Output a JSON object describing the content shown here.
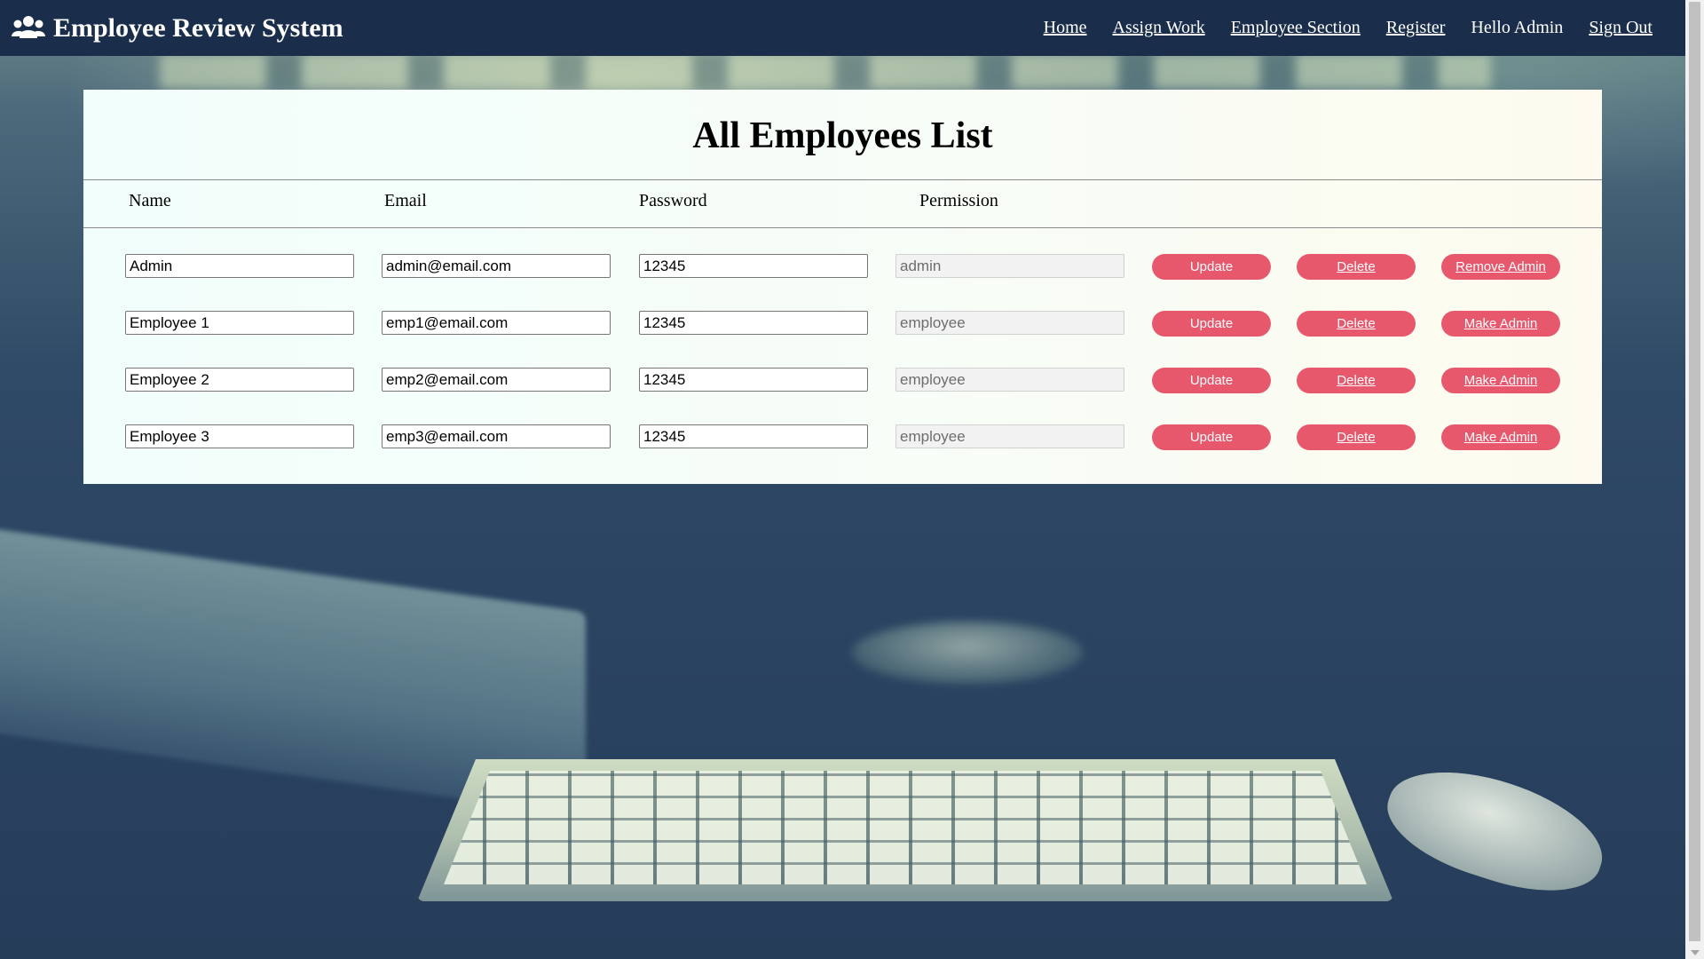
{
  "navbar": {
    "brand_icon": "users-icon",
    "brand_title": "Employee Review System",
    "links": {
      "home": "Home",
      "assign_work": "Assign Work",
      "employee_section": "Employee Section",
      "register": "Register",
      "greeting": "Hello Admin",
      "sign_out": "Sign Out"
    },
    "background_color": "#1a2e4c"
  },
  "panel": {
    "title": "All Employees List",
    "columns": {
      "name": "Name",
      "email": "Email",
      "password": "Password",
      "permission": "Permission"
    },
    "rows": [
      {
        "name": "Admin",
        "email": "admin@email.com",
        "password": "12345",
        "permission": "admin",
        "update_label": "Update",
        "delete_label": "Delete",
        "admin_action_label": "Remove Admin"
      },
      {
        "name": "Employee 1",
        "email": "emp1@email.com",
        "password": "12345",
        "permission": "employee",
        "update_label": "Update",
        "delete_label": "Delete",
        "admin_action_label": "Make Admin"
      },
      {
        "name": "Employee 2",
        "email": "emp2@email.com",
        "password": "12345",
        "permission": "employee",
        "update_label": "Update",
        "delete_label": "Delete",
        "admin_action_label": "Make Admin"
      },
      {
        "name": "Employee 3",
        "email": "emp3@email.com",
        "password": "12345",
        "permission": "employee",
        "update_label": "Update",
        "delete_label": "Delete",
        "admin_action_label": "Make Admin"
      }
    ],
    "button_color": "#e8586d"
  }
}
